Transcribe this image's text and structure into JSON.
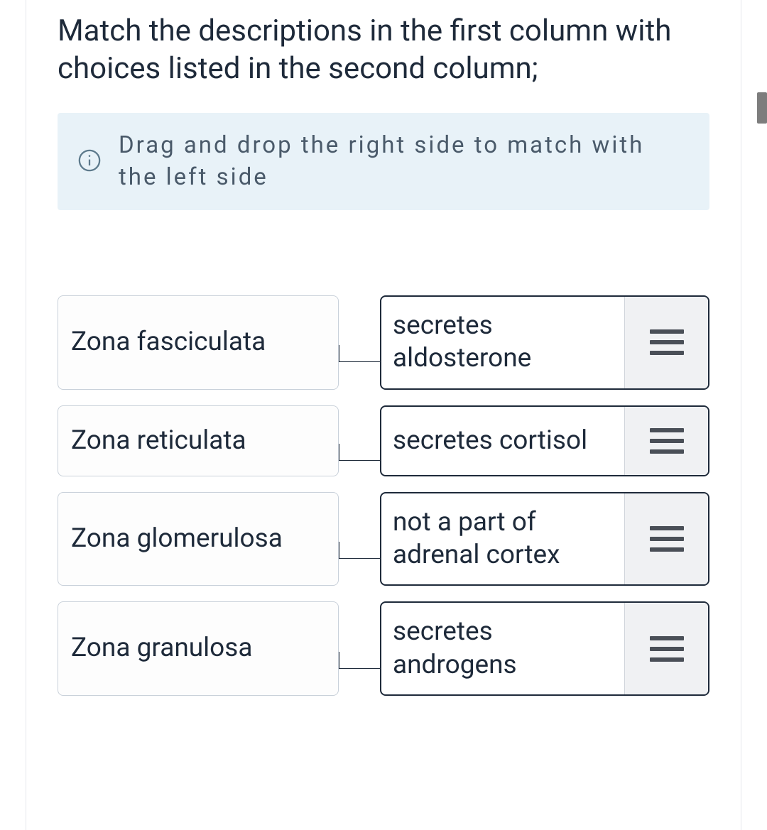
{
  "question": {
    "title": "Match the descriptions in the first column with choices listed in the second column;",
    "info_text": "Drag and drop the right side to match with the left side"
  },
  "rows": [
    {
      "left": "Zona fasciculata",
      "right": "secretes aldosterone"
    },
    {
      "left": "Zona reticulata",
      "right": "secretes cortisol"
    },
    {
      "left": "Zona glomerulosa",
      "right": "not a part of adrenal cortex"
    },
    {
      "left": "Zona granulosa",
      "right": "secretes androgens"
    }
  ]
}
